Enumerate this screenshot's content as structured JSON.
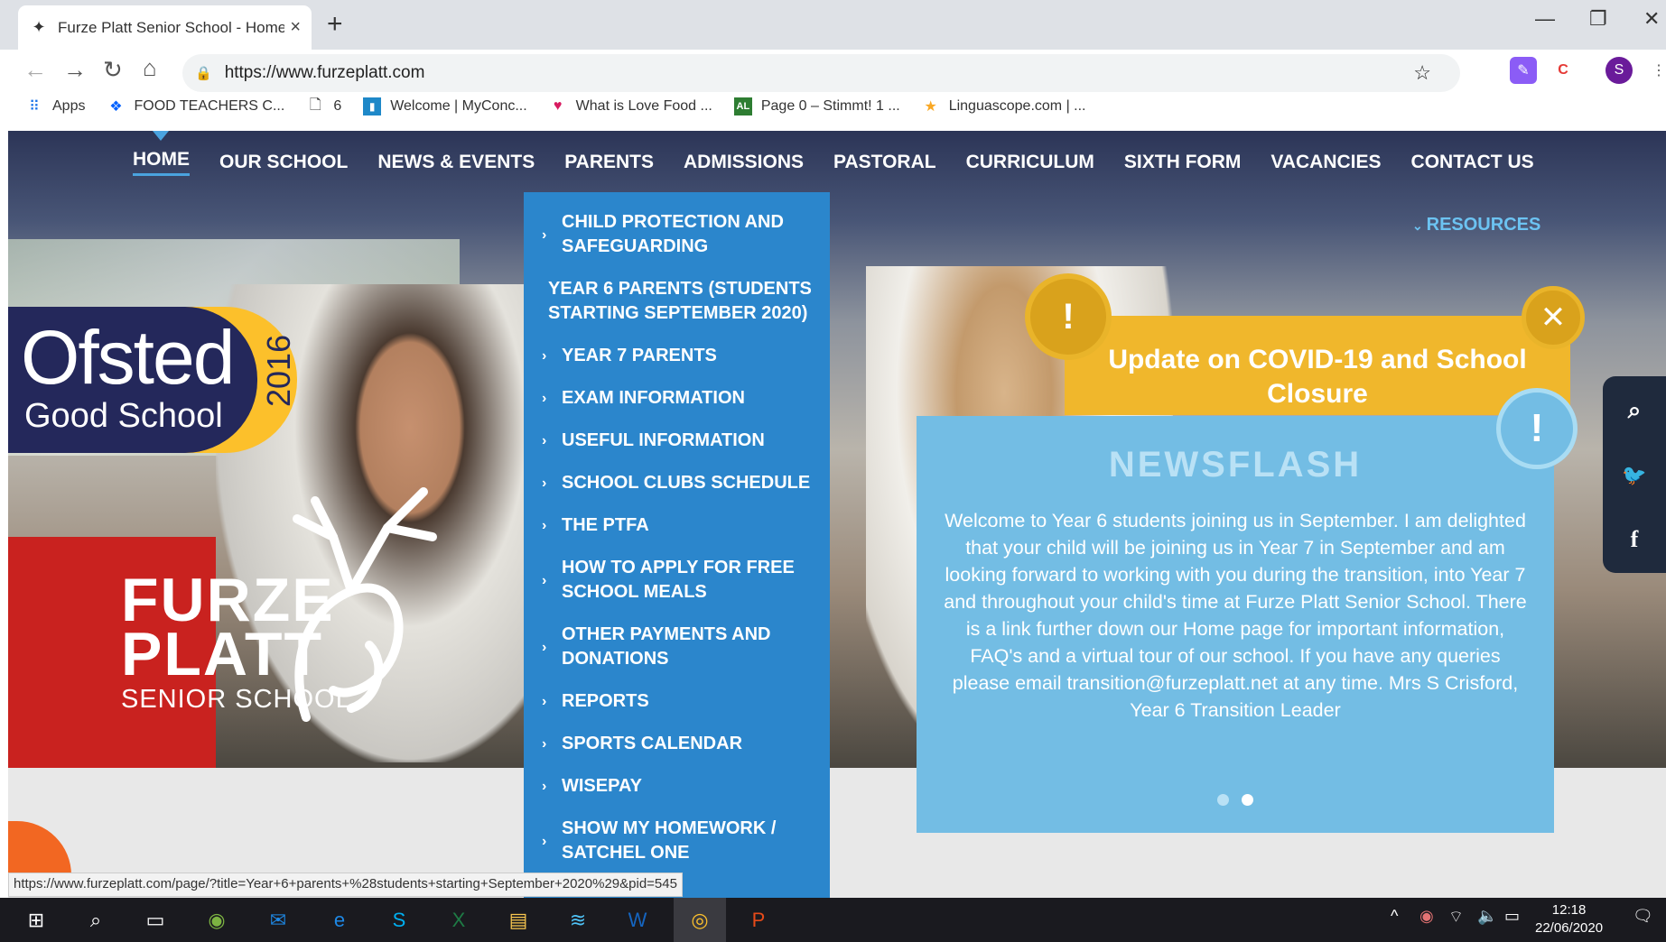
{
  "browser": {
    "tab_title": "Furze Platt Senior School - Home",
    "tab_close": "×",
    "new_tab": "+",
    "url": "https://www.furzeplatt.com",
    "window_controls": [
      "—",
      "❐",
      "✕"
    ],
    "profile_initial": "S",
    "bookmarks": [
      {
        "label": "Apps",
        "icon": "apps-grid-icon"
      },
      {
        "label": "FOOD TEACHERS C...",
        "icon": "dropbox-icon"
      },
      {
        "label": "6",
        "icon": "page-icon"
      },
      {
        "label": "Welcome | MyConc...",
        "icon": "myconcern-icon"
      },
      {
        "label": "What is Love Food ...",
        "icon": "heart-icon"
      },
      {
        "label": "Page 0 – Stimmt! 1 ...",
        "icon": "al-icon"
      },
      {
        "label": "Linguascope.com | ...",
        "icon": "linguascope-icon"
      }
    ]
  },
  "site": {
    "nav": [
      "HOME",
      "OUR SCHOOL",
      "NEWS & EVENTS",
      "PARENTS",
      "ADMISSIONS",
      "PASTORAL",
      "CURRICULUM",
      "SIXTH FORM",
      "VACANCIES",
      "CONTACT US"
    ],
    "resources": "RESOURCES",
    "parents_menu": [
      {
        "label": "CHILD PROTECTION AND SAFEGUARDING",
        "chevron": true
      },
      {
        "label": "YEAR 6 PARENTS (STUDENTS STARTING SEPTEMBER 2020)",
        "chevron": false
      },
      {
        "label": "YEAR 7 PARENTS",
        "chevron": true
      },
      {
        "label": "EXAM INFORMATION",
        "chevron": true
      },
      {
        "label": "USEFUL INFORMATION",
        "chevron": true
      },
      {
        "label": "SCHOOL CLUBS SCHEDULE",
        "chevron": true
      },
      {
        "label": "THE PTFA",
        "chevron": true
      },
      {
        "label": "HOW TO APPLY FOR FREE SCHOOL MEALS",
        "chevron": true
      },
      {
        "label": "OTHER PAYMENTS AND DONATIONS",
        "chevron": true
      },
      {
        "label": "REPORTS",
        "chevron": true
      },
      {
        "label": "SPORTS CALENDAR",
        "chevron": true
      },
      {
        "label": "WISEPAY",
        "chevron": true
      },
      {
        "label": "SHOW MY HOMEWORK / SATCHEL ONE",
        "chevron": true
      }
    ],
    "ofsted": {
      "big": "Ofsted",
      "small": "Good School",
      "year": "2016"
    },
    "school_logo": {
      "line1": "FURZE",
      "line2": "PLATT",
      "line3": "SENIOR SCHOOL"
    },
    "covid_title": "Update on COVID-19 and School Closure",
    "newsflash": {
      "heading": "NEWSFLASH",
      "body": "Welcome to Year 6 students joining us in September.  I am delighted that your child will be joining us in Year 7 in September and am looking forward to working with you during the transition, into Year 7 and throughout your child's time at Furze Platt Senior School. There is a link further down our Home page for important information, FAQ's and a virtual tour of our school. If you have any queries please email transition@furzeplatt.net at any time. Mrs S Crisford, Year 6 Transition Leader",
      "slides": 2,
      "active_slide": 2
    },
    "accent": "#2b86cc",
    "covid_color": "#f0b72c",
    "news_color": "#73bde4"
  },
  "status_url": "https://www.furzeplatt.com/page/?title=Year+6+parents+%28students+starting+September+2020%29&pid=545",
  "taskbar": {
    "time": "12:18",
    "date": "22/06/2020"
  }
}
